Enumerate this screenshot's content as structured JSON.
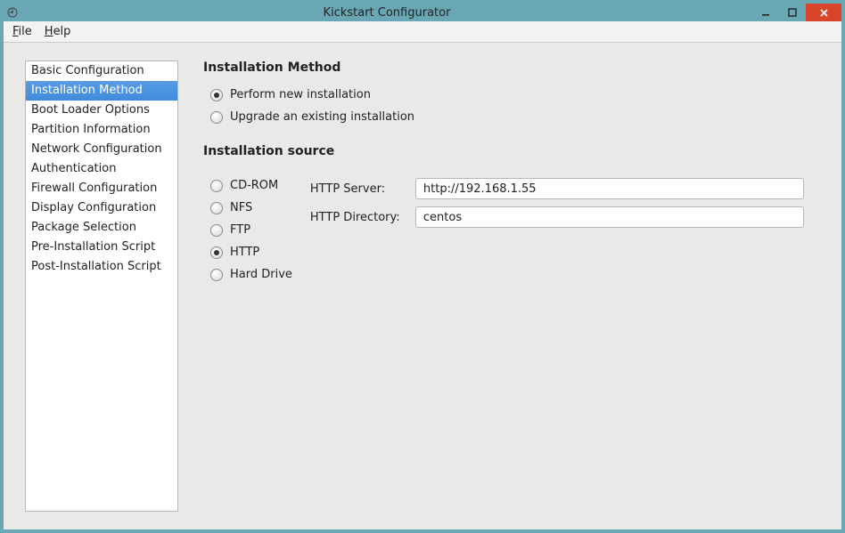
{
  "window": {
    "title": "Kickstart Configurator"
  },
  "menu": {
    "file": "File",
    "help": "Help"
  },
  "sidebar": {
    "items": [
      "Basic Configuration",
      "Installation Method",
      "Boot Loader Options",
      "Partition Information",
      "Network Configuration",
      "Authentication",
      "Firewall Configuration",
      "Display Configuration",
      "Package Selection",
      "Pre-Installation Script",
      "Post-Installation Script"
    ],
    "selected_index": 1
  },
  "main": {
    "section1_title": "Installation Method",
    "method_options": {
      "new_install": "Perform new installation",
      "upgrade": "Upgrade an existing installation",
      "selected": "new_install"
    },
    "section2_title": "Installation source",
    "source_options": {
      "cdrom": "CD-ROM",
      "nfs": "NFS",
      "ftp": "FTP",
      "http": "HTTP",
      "harddrive": "Hard Drive",
      "selected": "http"
    },
    "http_server_label": "HTTP Server:",
    "http_server_value": "http://192.168.1.55",
    "http_dir_label": "HTTP Directory:",
    "http_dir_value": "centos"
  }
}
